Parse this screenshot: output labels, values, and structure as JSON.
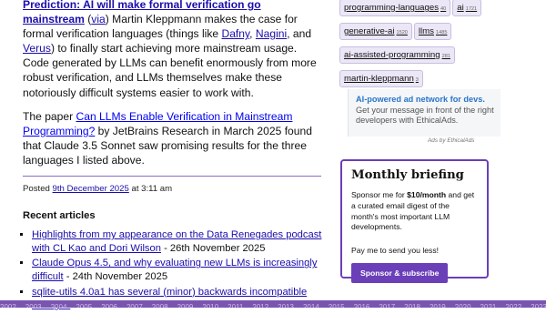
{
  "main": {
    "intro": {
      "link_text": "Prediction: AI will make formal verification go mainstream",
      "via_open": " (",
      "via_label": "via",
      "text1": ") Martin Kleppmann makes the case for formal verification languages (things like ",
      "lang1": "Dafny",
      "comma1": ", ",
      "lang2": "Nagini",
      "and": ", and ",
      "lang3": "Verus",
      "text2": ") to finally start achieving more mainstream usage. Code generated by LLMs can benefit enormously from more robust verification, and LLMs themselves make these notoriously difficult systems easier to work with."
    },
    "para2": {
      "prefix": "The paper ",
      "link": "Can LLMs Enable Verification in Mainstream Programming?",
      "text": " by JetBrains Research in March 2025 found that Claude 3.5 Sonnet saw promising results for the three languages I listed above."
    },
    "posted": {
      "prefix": "Posted ",
      "date": "9th December 2025",
      "suffix": " at 3:11 am"
    },
    "recent_heading": "Recent articles",
    "recent": [
      {
        "title": "Highlights from my appearance on the Data Renegades podcast with CL Kao and Dori Wilson",
        "date": " - 26th November 2025"
      },
      {
        "title": "Claude Opus 4.5, and why evaluating new LLMs is increasingly difficult",
        "date": " - 24th November 2025"
      },
      {
        "title": "sqlite-utils 4.0a1 has several (minor) backwards incompatible changes",
        "date": " - 24th November 2025"
      }
    ]
  },
  "sidebar": {
    "tags": [
      {
        "name": "programming-languages",
        "count": "40"
      },
      {
        "name": "ai",
        "count": "1721"
      },
      {
        "name": "generative-ai",
        "count": "1520"
      },
      {
        "name": "llms",
        "count": "1485"
      },
      {
        "name": "ai-assisted-programming",
        "count": "281"
      },
      {
        "name": "martin-kleppmann",
        "count": "3"
      }
    ],
    "ad": {
      "headline": "AI-powered ad network for devs.",
      "body": " Get your message in front of the right developers with EthicalAds.",
      "credit": "Ads by EthicalAds"
    },
    "briefing": {
      "title": "Monthly briefing",
      "text_prefix": "Sponsor me for ",
      "price": "$10/month",
      "text_suffix": " and get a curated email digest of the month's most important LLM developments.",
      "cta": "Pay me to send you less!",
      "button": "Sponsor & subscribe"
    }
  },
  "footer": {
    "years": [
      "2002",
      "2003",
      "2004",
      "2005",
      "2006",
      "2007",
      "2008",
      "2009",
      "2010",
      "2011",
      "2012",
      "2013",
      "2014",
      "2015",
      "2016",
      "2017",
      "2018",
      "2019",
      "2020",
      "2021",
      "2022",
      "2023",
      "2024",
      "2025"
    ]
  },
  "colors": {
    "accent": "#6a3fb8",
    "link": "#1a0dab",
    "tag_bg": "#ece7f6",
    "ad_headline": "#2a74c8",
    "footer": "#7a55b0"
  }
}
